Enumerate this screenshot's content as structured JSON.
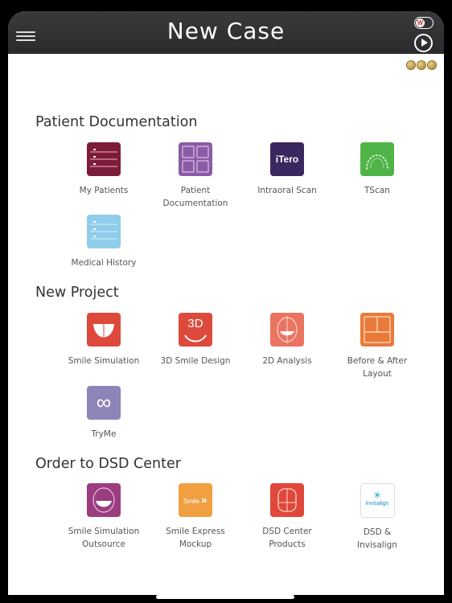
{
  "header": {
    "title": "New Case",
    "toggle_letter": "W"
  },
  "sections": [
    {
      "title": "Patient Documentation",
      "items": [
        "My Patients",
        "Patient Documentation",
        "Intraoral Scan",
        "TScan",
        "Medical History"
      ]
    },
    {
      "title": "New Project",
      "items": [
        "Smile Simulation",
        "3D Smile Design",
        "2D Analysis",
        "Before & After Layout",
        "TryMe"
      ]
    },
    {
      "title": "Order to DSD Center",
      "items": [
        "Smile Simulation Outsource",
        "Smile Express Mockup",
        "DSD Center Products",
        "DSD & Invisalign"
      ]
    }
  ],
  "icon_text": {
    "itero": "iTero",
    "3d": "3D",
    "smile": "Smile",
    "invisalign": "invisalign"
  },
  "colors": {
    "header": "#333335",
    "accent_gold": "#c9a54a"
  }
}
